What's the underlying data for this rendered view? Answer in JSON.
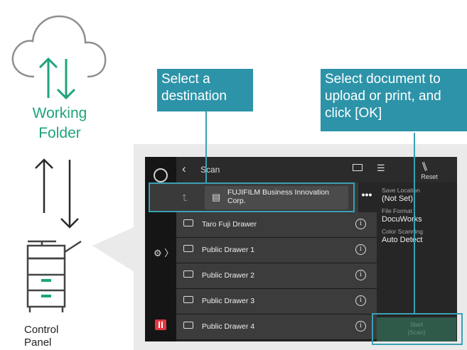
{
  "illustration": {
    "cloud_label": "Working\nFolder",
    "device_label": "Control\nPanel"
  },
  "callouts": {
    "destination": "Select a destination",
    "document": "Select document to upload or print, and click [OK]"
  },
  "screen": {
    "title": "Scan",
    "reset_label": "Reset",
    "breadcrumb": "FUJIFILM Business Innovation Corp.",
    "more_label": "•••",
    "drawers": [
      {
        "label": "Taro Fuji Drawer"
      },
      {
        "label": "Public Drawer 1"
      },
      {
        "label": "Public Drawer 2"
      },
      {
        "label": "Public Drawer 3"
      },
      {
        "label": "Public Drawer 4"
      }
    ],
    "settings": {
      "save_location_label": "Save Location",
      "save_location_value": "(Not Set)",
      "file_format_label": "File Format",
      "file_format_value": "DocuWorks",
      "color_label": "Color Scanning",
      "color_value": "Auto Detect"
    },
    "start_label": "Start",
    "start_sub": "(Scan)"
  },
  "colors": {
    "accent": "#2c93a8",
    "green": "#1fa37d",
    "pause": "#e03840"
  }
}
